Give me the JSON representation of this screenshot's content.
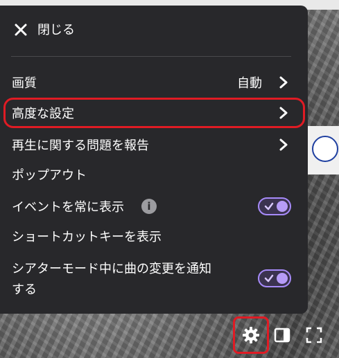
{
  "menu": {
    "close_label": "閉じる",
    "items": [
      {
        "label": "画質",
        "value": "自動"
      },
      {
        "label": "高度な設定"
      },
      {
        "label": "再生に関する問題を報告"
      },
      {
        "label": "ポップアウト"
      },
      {
        "label": "イベントを常に表示",
        "info_icon": "info-icon",
        "toggle": true
      },
      {
        "label": "ショートカットキーを表示"
      },
      {
        "label_line1": "シアターモード中に曲の変更を通知",
        "label_line2": "する",
        "toggle": true
      }
    ]
  },
  "colors": {
    "menu_bg": "#28282b",
    "toggle_accent": "#a78bfa",
    "highlight": "#e01b24"
  },
  "controls": {
    "icons": [
      "gear-icon",
      "sidebar-panel-icon",
      "fullscreen-icon"
    ]
  }
}
